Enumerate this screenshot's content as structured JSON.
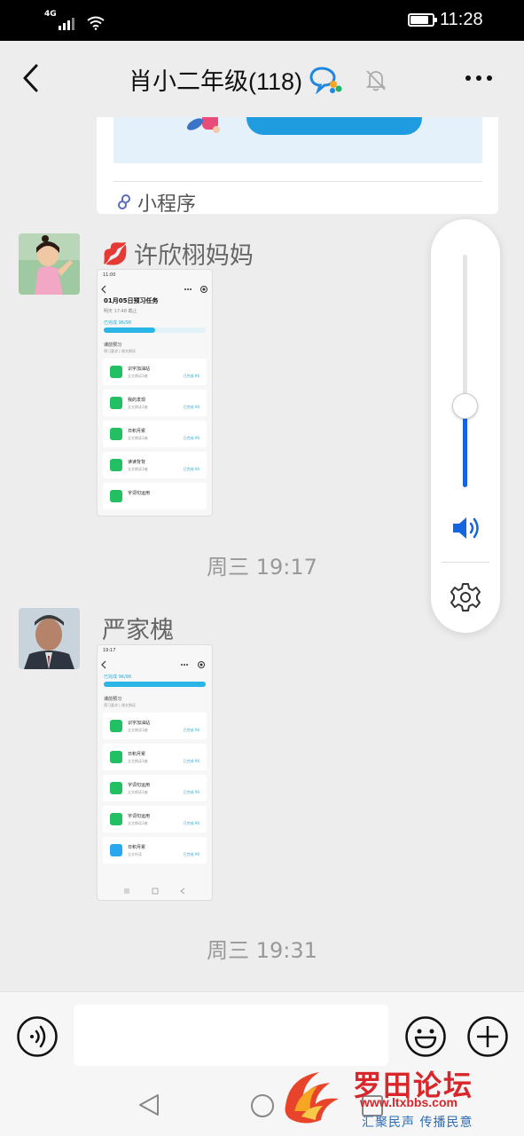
{
  "status_bar": {
    "network": "4G",
    "time": "11:28",
    "battery_level": 0.85
  },
  "header": {
    "title": "肖小二年级(118)",
    "back_icon": "back-arrow-icon",
    "group_icon": "group-chat-icon",
    "mute_icon": "bell-muted-icon",
    "more_icon": "more-dots-icon"
  },
  "mini_program_card": {
    "label": "小程序",
    "icon": "link-icon"
  },
  "messages": [
    {
      "sender": "许欣栩妈妈",
      "sender_emoji": "💋",
      "screenshot": {
        "status_time": "11:00",
        "title": "01月05日预习任务",
        "subtitle": "明天 17:48 截止",
        "progress_label": "已完成 96/98",
        "progress": 0.5,
        "section_title": "课前预习",
        "section_sub": "预习要求 | 课文朗读",
        "items": [
          {
            "name": "识字加油站",
            "meta": "全文朗读3遍",
            "stat": "已完成 96"
          },
          {
            "name": "我的发现",
            "meta": "全文朗读3遍",
            "stat": "已完成 96"
          },
          {
            "name": "日积月累",
            "meta": "全文朗读3遍",
            "stat": "已完成 96"
          },
          {
            "name": "读读背背",
            "meta": "全文朗读3遍",
            "stat": "已完成 96"
          },
          {
            "name": "字词句运用",
            "meta": "",
            "stat": ""
          }
        ]
      }
    },
    {
      "sender": "严家槐",
      "screenshot": {
        "status_time": "19:17",
        "progress_label": "已完成 96/98",
        "progress": 1.0,
        "section_title": "课前预习",
        "section_sub": "预习要求 | 课文朗读",
        "items": [
          {
            "name": "识字加油站",
            "meta": "全文朗读3遍",
            "stat": "已完成 96"
          },
          {
            "name": "日积月累",
            "meta": "全文朗读3遍",
            "stat": "已完成 96"
          },
          {
            "name": "字词句运用",
            "meta": "全文朗读3遍",
            "stat": "已完成 96"
          },
          {
            "name": "字词句运用",
            "meta": "全文朗读3遍",
            "stat": "已完成 96"
          },
          {
            "name": "日积月累",
            "meta": "全文听读",
            "stat": "已完成 96"
          }
        ]
      }
    }
  ],
  "timestamps": [
    "周三 19:17",
    "周三 19:31"
  ],
  "volume_panel": {
    "level": 0.35,
    "speaker_icon": "speaker-icon",
    "settings_icon": "gear-icon"
  },
  "input_bar": {
    "placeholder": "",
    "value": ""
  },
  "watermark": {
    "title": "罗田论坛",
    "url": "www.ltxbbs.com",
    "slogan": "汇聚民声 传播民意"
  },
  "colors": {
    "accent": "#1565e0",
    "background": "#ededed",
    "watermark": "#d8262a"
  }
}
